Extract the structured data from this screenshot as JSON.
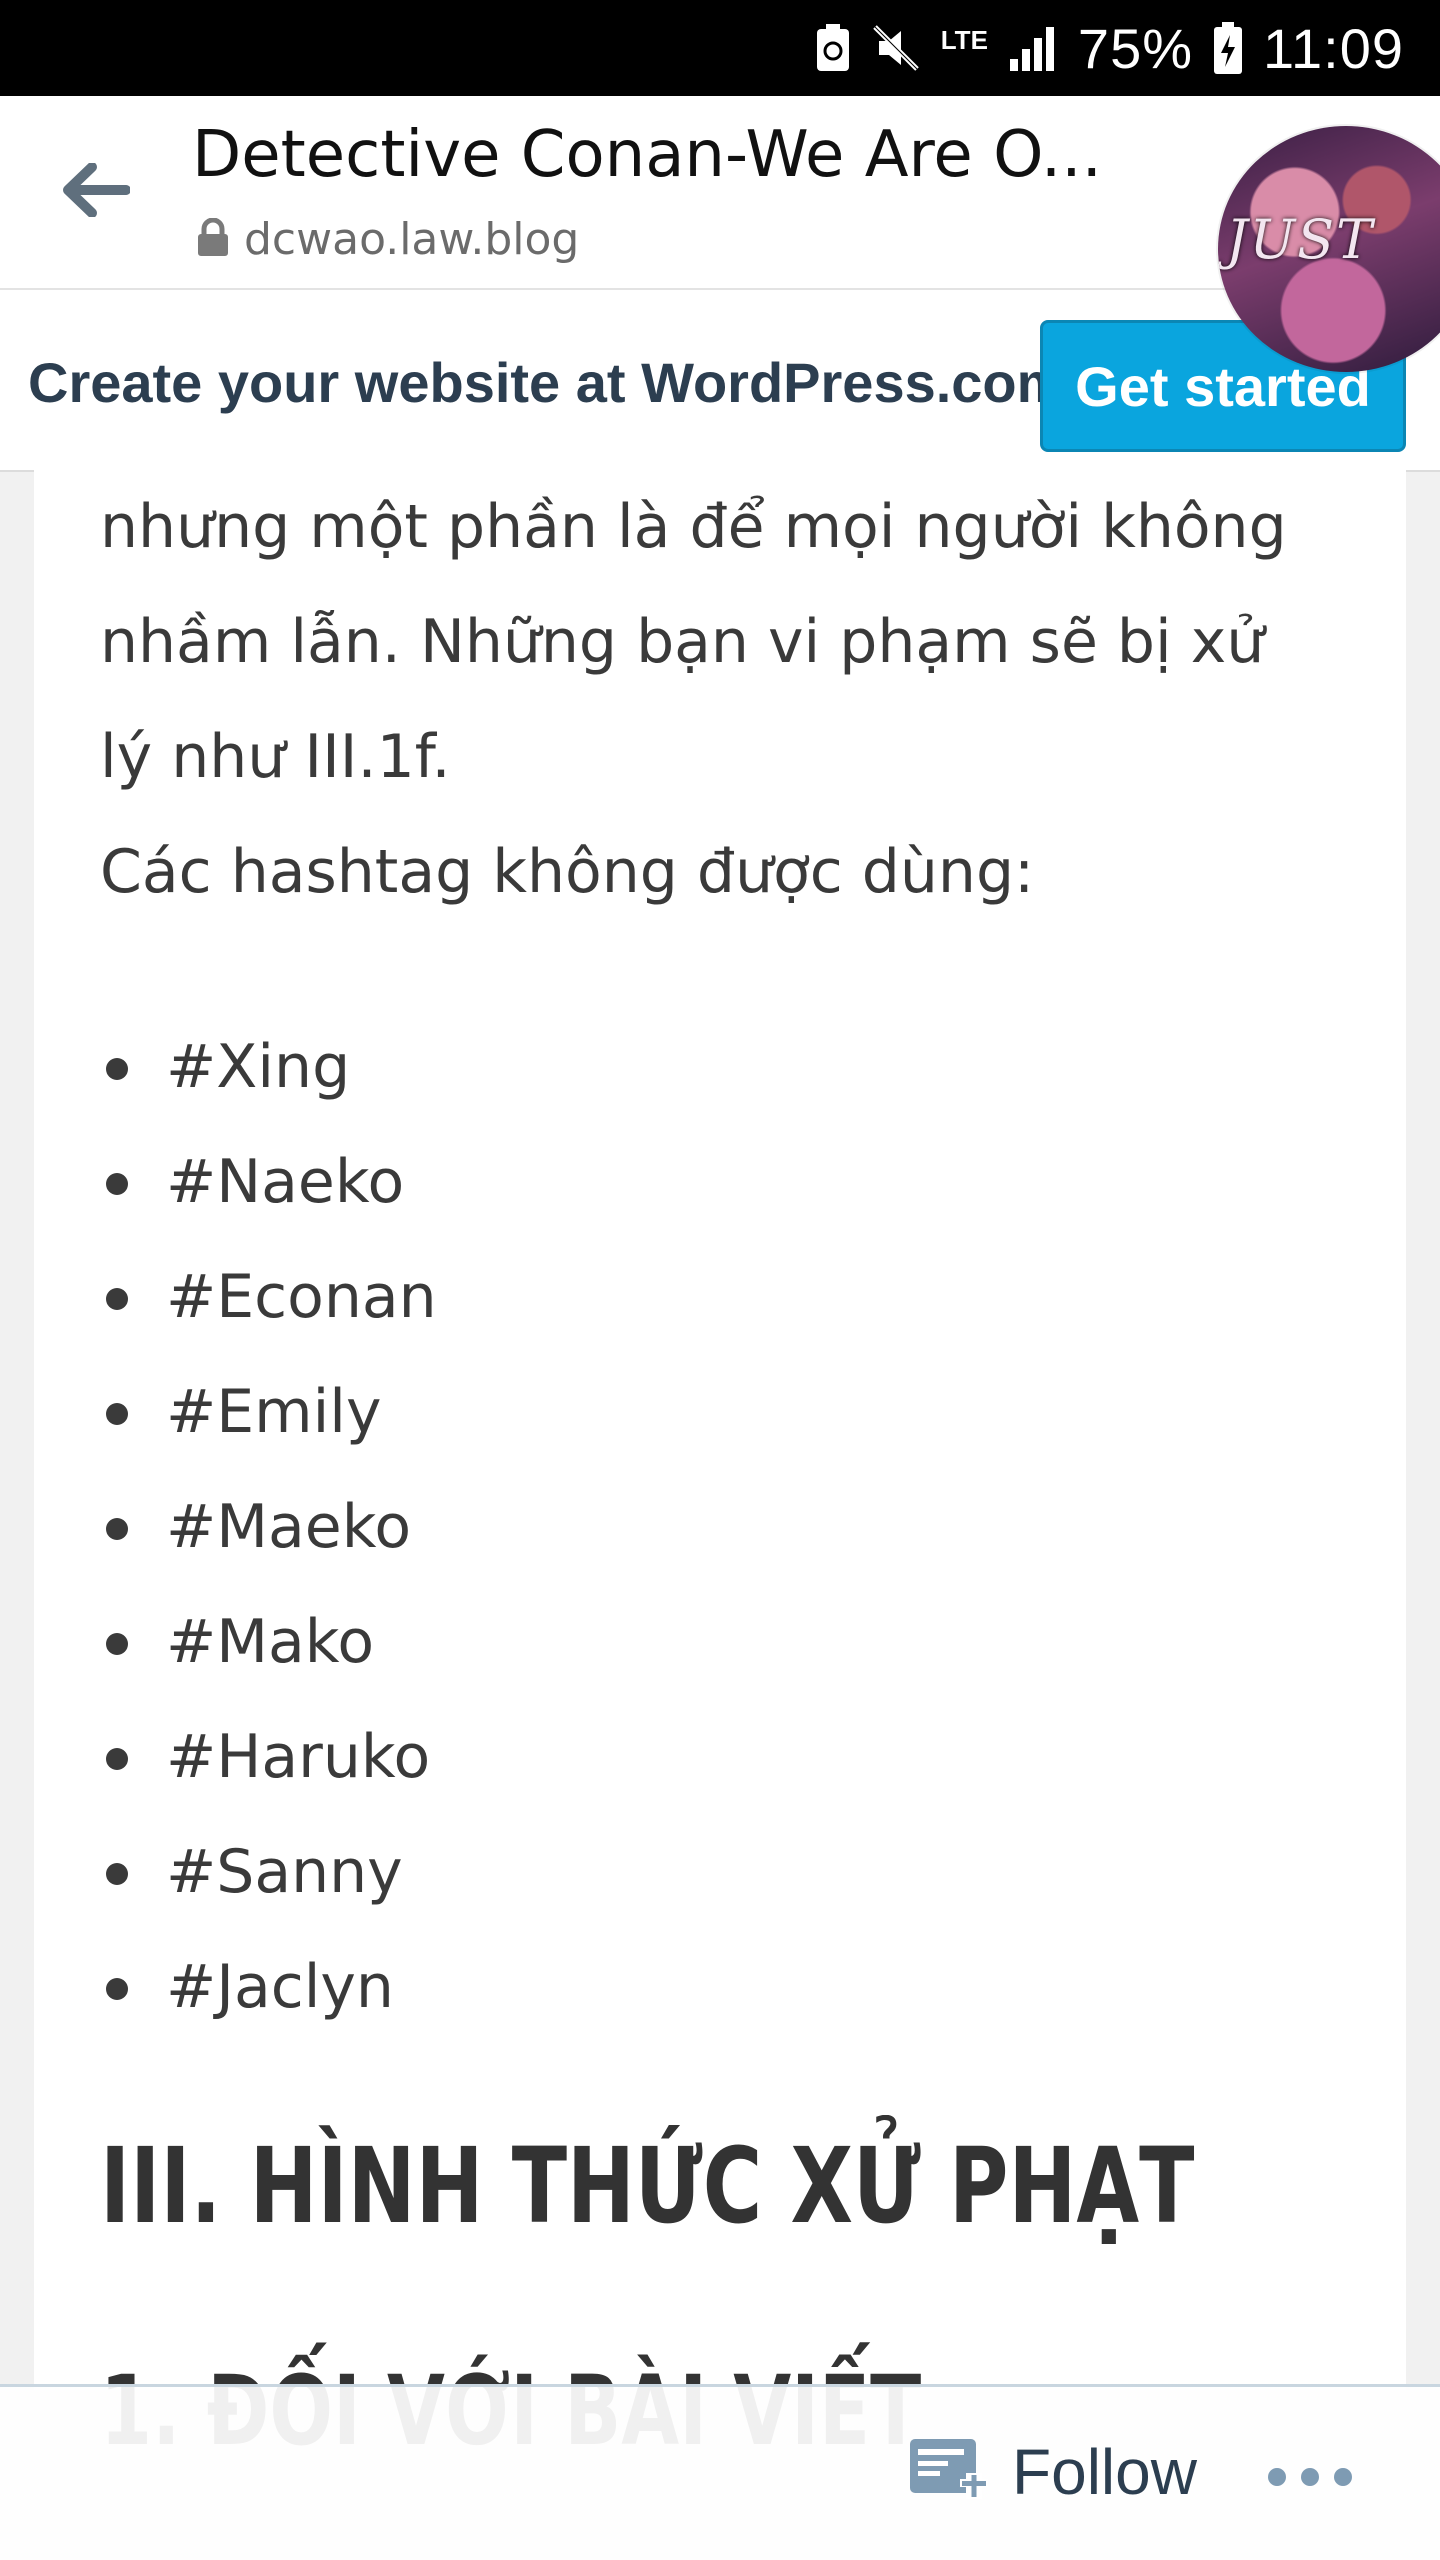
{
  "status_bar": {
    "battery_percent": "75%",
    "time": "11:09",
    "network": "LTE",
    "icons": [
      "battery-saver-icon",
      "mute-icon",
      "lte-data-icon",
      "signal-icon",
      "battery-charging-icon"
    ]
  },
  "browser": {
    "back_icon": "back-arrow-icon",
    "title": "Detective Conan-We Are O...",
    "url": "dcwao.law.blog",
    "lock_icon": "lock-icon",
    "avatar_text": "JUST"
  },
  "banner": {
    "text": "Create your website at WordPress.com",
    "button": "Get started",
    "button_color": "#0aa5de"
  },
  "content": {
    "paragraph_lines": [
      "nhưng một phần là để mọi người không",
      "nhầm lẫn. Những bạn vi phạm sẽ bị xử",
      "lý như III.1f.",
      "Các hashtag không được dùng:"
    ],
    "hashtags": [
      "#Xing",
      "#Naeko",
      "#Econan",
      "#Emily",
      "#Maeko",
      "#Mako",
      "#Haruko",
      "#Sanny",
      "#Jaclyn"
    ],
    "section_heading": "III. HÌNH THỨC XỬ PHẠT",
    "sub_heading": "1. ĐỐI VỚI BÀI VIẾT"
  },
  "follow_bar": {
    "follow_label": "Follow",
    "follow_icon": "reader-follow-icon",
    "more_icon": "more-options-icon"
  }
}
